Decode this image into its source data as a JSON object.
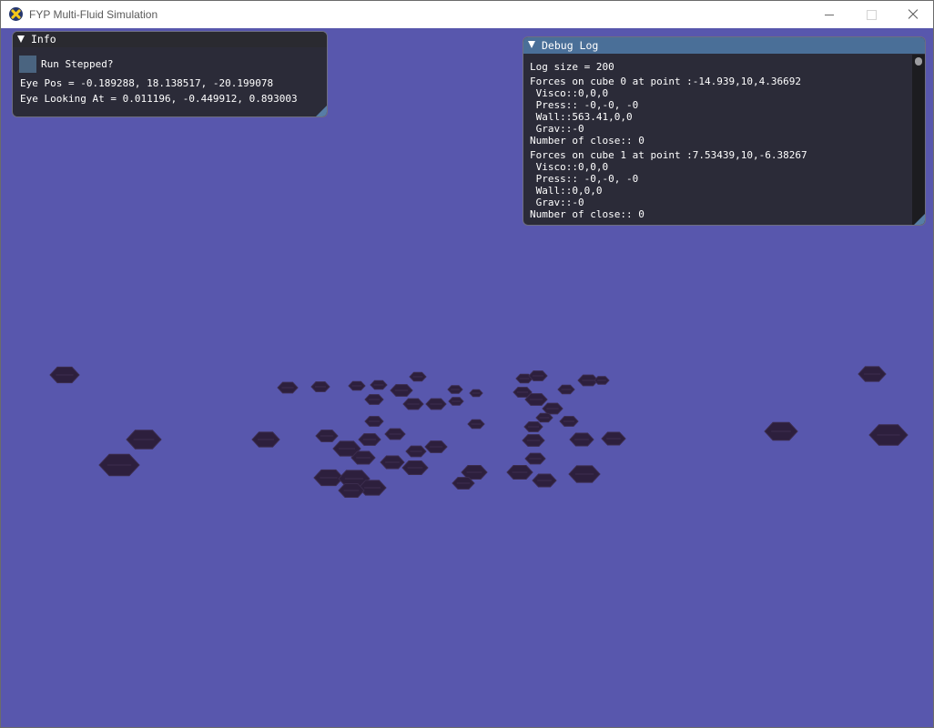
{
  "window": {
    "title": "FYP Multi-Fluid Simulation",
    "icon": "app-icon",
    "controls": [
      "minimize-icon",
      "maximize-icon",
      "close-icon"
    ]
  },
  "colors": {
    "background": "#5857ad",
    "particle": "#2d1f3d",
    "panel": "#26262c",
    "panel_title_active": "#4a6f98",
    "checkbox": "#4a6480"
  },
  "info_panel": {
    "title": "Info",
    "checkbox_label": "Run Stepped?",
    "checkbox_checked": false,
    "eye_pos": "Eye Pos = -0.189288, 18.138517, -20.199078",
    "eye_look": "Eye Looking At = 0.011196, -0.449912, 0.893003"
  },
  "debug_panel": {
    "title": "Debug Log",
    "lines": [
      "Log size = 200",
      "Forces on cube 0 at point :-14.939,10,4.36692",
      " Visco::0,0,0",
      " Press:: -0,-0, -0",
      " Wall::563.41,0,0",
      " Grav::-0",
      "Number of close:: 0",
      "Forces on cube 1 at point :7.53439,10,-6.38267",
      " Visco::0,0,0",
      " Press:: -0,-0, -0",
      " Wall::0,0,0",
      " Grav::-0",
      "Number of close:: 0"
    ]
  }
}
